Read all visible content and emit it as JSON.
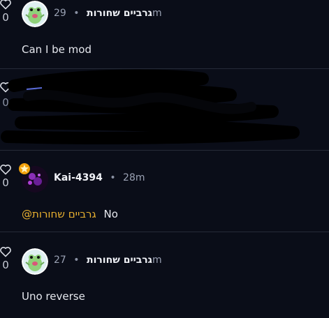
{
  "comments": [
    {
      "username": "גרביים שחורות",
      "time": "29m",
      "text": "Can I be mod",
      "likes": "0"
    },
    {
      "username": "",
      "time": "",
      "text": "",
      "likes": "0",
      "redacted": true
    },
    {
      "username": "Kai-4394",
      "time": "28m",
      "mention": "@גרביים שחורות",
      "text": "No",
      "likes": "0",
      "badge": "star"
    },
    {
      "username": "גרביים שחורות",
      "time": "27m",
      "text": "Uno reverse",
      "likes": "0"
    }
  ],
  "separator": "•",
  "icons": {
    "like": "heart-outline-icon",
    "badge": "star-badge-icon"
  },
  "colors": {
    "background": "#0a0d18",
    "mention": "#e8b030",
    "badge": "#f2a10b",
    "avatar_frog": "#8fd17a",
    "avatar_kai": "#1a0a24"
  }
}
